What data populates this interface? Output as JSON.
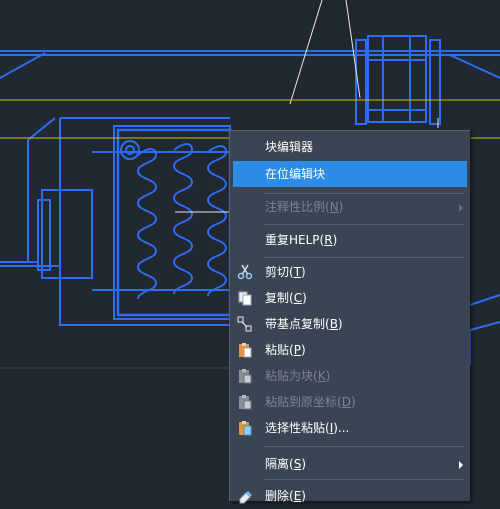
{
  "theme": {
    "canvas_bg": "#212830",
    "cad_line": "#2d6df6",
    "guide_line": "#c9c400",
    "menu_bg": "#3b4453",
    "highlight": "#2d8ce6"
  },
  "context_menu": {
    "items": [
      {
        "label": "块编辑器",
        "key": null,
        "enabled": true
      },
      {
        "label": "在位编辑块",
        "key": null,
        "enabled": true,
        "highlighted": true
      },
      {
        "label": "注释性比例(",
        "key": "N",
        "tail": ")",
        "enabled": false,
        "submenu": true
      },
      {
        "label": "重复HELP(",
        "key": "R",
        "tail": ")",
        "enabled": true
      },
      {
        "label": "剪切(",
        "key": "T",
        "tail": ")",
        "enabled": true,
        "icon": "scissors-icon"
      },
      {
        "label": "复制(",
        "key": "C",
        "tail": ")",
        "enabled": true,
        "icon": "copy-icon"
      },
      {
        "label": "带基点复制(",
        "key": "B",
        "tail": ")",
        "enabled": true,
        "icon": "copy-with-basepoint-icon"
      },
      {
        "label": "粘贴(",
        "key": "P",
        "tail": ")",
        "enabled": true,
        "icon": "paste-icon"
      },
      {
        "label": "粘贴为块(",
        "key": "K",
        "tail": ")",
        "enabled": false,
        "icon": "paste-as-block-icon"
      },
      {
        "label": "粘贴到原坐标(",
        "key": "D",
        "tail": ")",
        "enabled": false,
        "icon": "paste-to-original-coords-icon"
      },
      {
        "label": "选择性粘贴(",
        "key": "I",
        "tail": ")...",
        "enabled": true,
        "icon": "paste-special-icon"
      },
      {
        "label": "隔离(",
        "key": "S",
        "tail": ")",
        "enabled": true,
        "submenu": true
      },
      {
        "label": "删除(",
        "key": "E",
        "tail": ")",
        "enabled": true,
        "icon": "eraser-icon"
      }
    ]
  }
}
